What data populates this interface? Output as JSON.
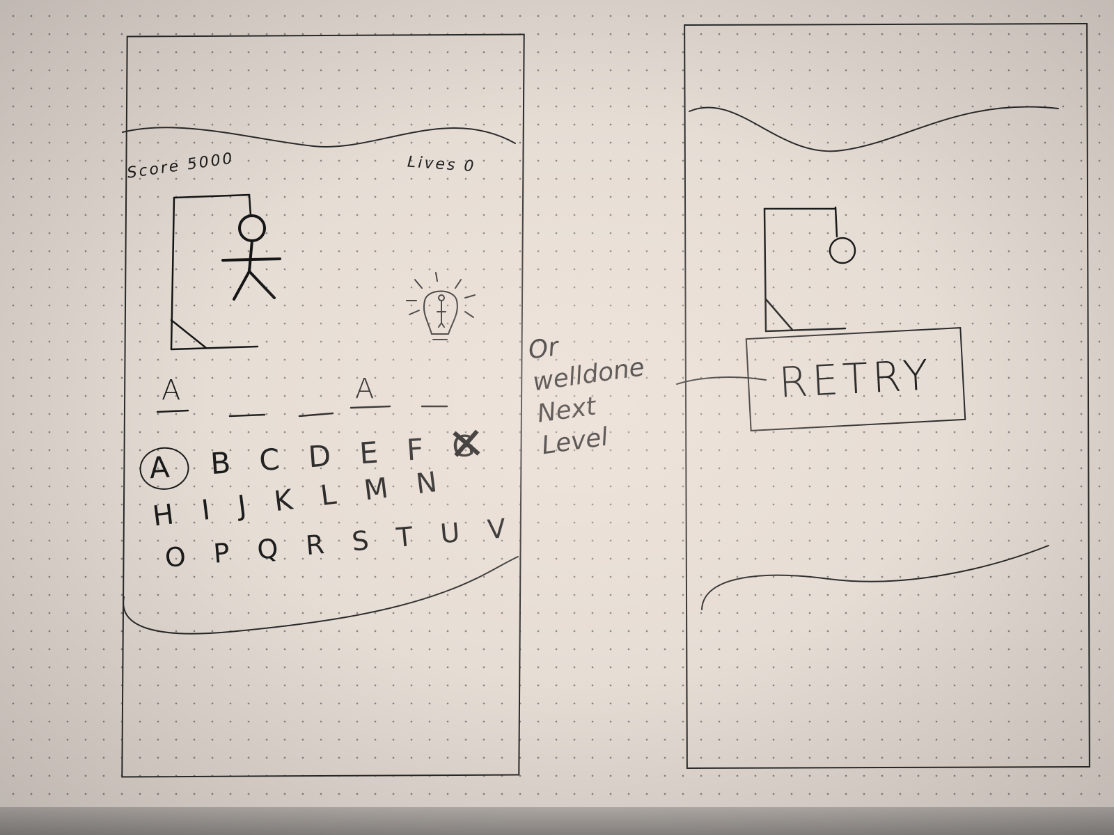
{
  "game_screen": {
    "score_label": "Score 5000",
    "lives_label": "Lives 0",
    "word_letters": [
      "A",
      "",
      "",
      "A",
      ""
    ],
    "alphabet_rows": [
      [
        "A",
        "B",
        "C",
        "D",
        "E",
        "F",
        "G"
      ],
      [
        "H",
        "I",
        "J",
        "K",
        "L",
        "M",
        "N"
      ],
      [
        "O",
        "P",
        "Q",
        "R",
        "S",
        "T",
        "U",
        "V"
      ]
    ],
    "selected_letter": "A",
    "crossed_letter": "G",
    "hint_icon": "lightbulb-icon"
  },
  "annotation": {
    "lines": [
      "Or",
      "welldone",
      "Next",
      "Level"
    ]
  },
  "game_over_screen": {
    "retry_label": "RETRY"
  },
  "colors": {
    "paper": "#e6ddd5",
    "ink": "#1b1b1b"
  }
}
